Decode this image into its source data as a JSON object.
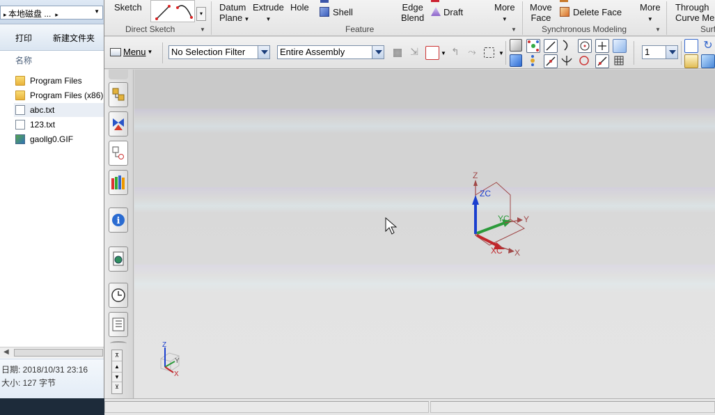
{
  "explorer": {
    "breadcrumb": "本地磁盘 ...",
    "commands": {
      "print": "打印",
      "new_folder": "新建文件夹"
    },
    "column_header": "名称",
    "files": [
      {
        "name": "Program Files",
        "type": "folder"
      },
      {
        "name": "Program Files (x86)",
        "type": "folder"
      },
      {
        "name": "abc.txt",
        "type": "txt",
        "selected": true
      },
      {
        "name": "123.txt",
        "type": "txt"
      },
      {
        "name": "gaollg0.GIF",
        "type": "gif"
      }
    ],
    "details": {
      "date": "日期:  2018/10/31 23:16",
      "size": "大小:  127 字节"
    }
  },
  "ribbon": {
    "sketch": "Sketch",
    "direct_sketch_group": "Direct Sketch",
    "datum_plane": [
      "Datum",
      "Plane"
    ],
    "extrude": "Extrude",
    "hole": "Hole",
    "shell": "Shell",
    "edge_blend": [
      "Edge",
      "Blend"
    ],
    "draft": "Draft",
    "more1": "More",
    "feature_group": "Feature",
    "move_face": [
      "Move",
      "Face"
    ],
    "delete_face": "Delete Face",
    "more2": "More",
    "sync_group": "Synchronous Modeling",
    "through_curve_mesh": [
      "Through",
      "Curve Mesh"
    ],
    "surface_group": "Surf"
  },
  "toolbar": {
    "menu": "Menu",
    "selection_filter": "No Selection Filter",
    "assembly_scope": "Entire Assembly",
    "layer_value": "1"
  },
  "triad": {
    "z": "Z",
    "zc": "ZC",
    "yc": "YC",
    "y": "Y",
    "xc": "XC",
    "x": "X"
  },
  "mini_triad": {
    "z": "Z",
    "y": "Y",
    "x": "X"
  },
  "colors": {
    "z_axis": "#1a3fcf",
    "y_axis": "#2b9a3a",
    "x_axis": "#c0262b",
    "axis_outline": "#a04848"
  }
}
